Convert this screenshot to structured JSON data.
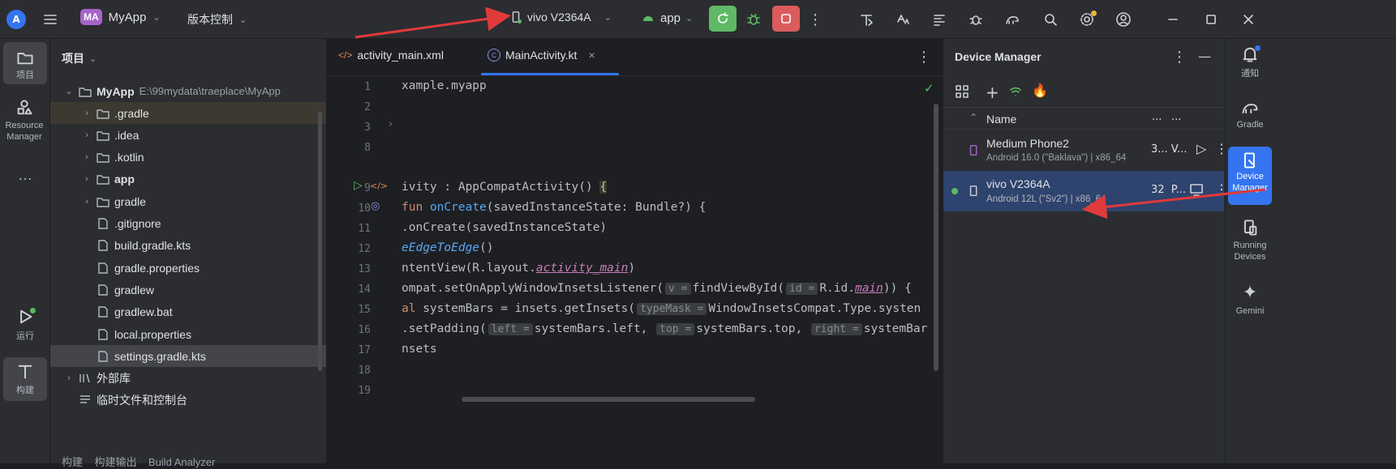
{
  "topbar": {
    "project_badge": "MA",
    "project_name": "MyApp",
    "vcs_label": "版本控制",
    "device_name": "vivo V2364A",
    "run_config": "app"
  },
  "left_strip": {
    "project_label": "项目",
    "resource_manager_label": "Resource Manager",
    "more_label": "…",
    "run_label": "运行",
    "build_label": "构建"
  },
  "project_panel": {
    "title": "项目",
    "root_name": "MyApp",
    "root_path": "E:\\99mydata\\traeplace\\MyApp",
    "items": [
      {
        "label": ".gradle"
      },
      {
        "label": ".idea"
      },
      {
        "label": ".kotlin"
      },
      {
        "label": "app"
      },
      {
        "label": "gradle"
      },
      {
        "label": ".gitignore"
      },
      {
        "label": "build.gradle.kts"
      },
      {
        "label": "gradle.properties"
      },
      {
        "label": "gradlew"
      },
      {
        "label": "gradlew.bat"
      },
      {
        "label": "local.properties"
      },
      {
        "label": "settings.gradle.kts"
      }
    ],
    "external_libs": "外部库",
    "scratches": "临时文件和控制台",
    "bottom_cut": "构建    构建输出    Build Analyzer"
  },
  "editor": {
    "tabs": [
      {
        "label": "activity_main.xml"
      },
      {
        "label": "MainActivity.kt"
      }
    ],
    "line_numbers": [
      "1",
      "2",
      "3",
      "8",
      "9",
      "10",
      "11",
      "12",
      "13",
      "14",
      "15",
      "16",
      "17",
      "18",
      "19"
    ]
  },
  "device_manager": {
    "title": "Device Manager",
    "col_name": "Name",
    "col_more1": "...",
    "col_more2": "...",
    "devices": [
      {
        "name": "Medium Phone2",
        "sub": "Android 16.0 (\"Baklava\") | x86_64",
        "col": "3... V..."
      },
      {
        "name": "vivo V2364A",
        "sub": "Android 12L (\"Sv2\") | x86_64",
        "col": "32  P..."
      }
    ]
  },
  "right_strip": {
    "notifications": "通知",
    "gradle": "Gradle",
    "device_manager": "Device Manager",
    "running_devices": "Running Devices",
    "gemini": "Gemini"
  },
  "colors": {
    "accent": "#3574f0",
    "run_green": "#5fb865",
    "stop_red": "#db5c5c",
    "arrow_red": "#e03a3a"
  }
}
